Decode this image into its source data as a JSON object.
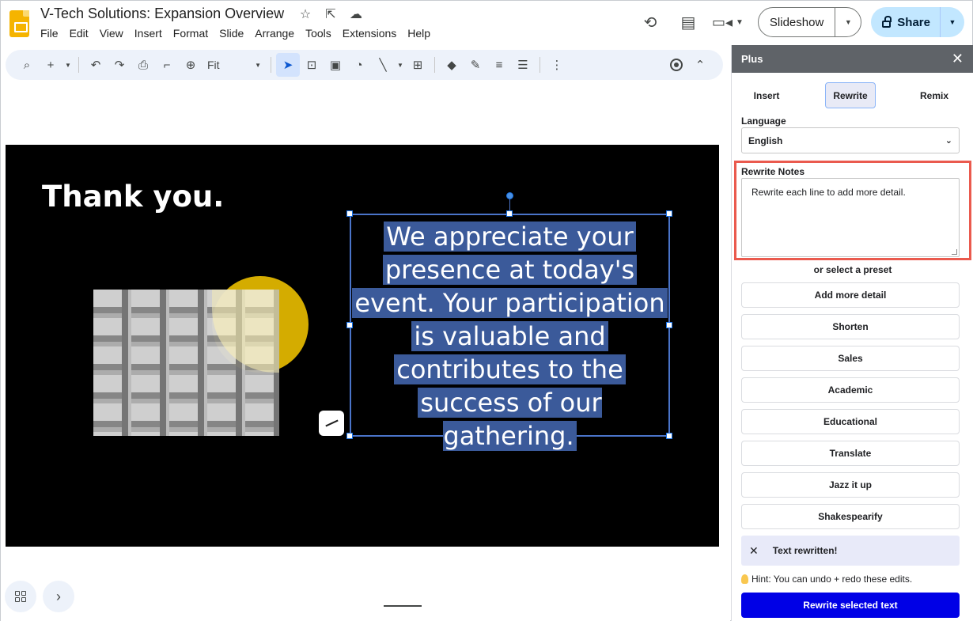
{
  "window": {
    "doc_title": "V-Tech Solutions: Expansion Overview",
    "menus": [
      "File",
      "Edit",
      "View",
      "Insert",
      "Format",
      "Slide",
      "Arrange",
      "Tools",
      "Extensions",
      "Help"
    ],
    "slideshow_label": "Slideshow",
    "share_label": "Share"
  },
  "toolbar": {
    "zoom_value": "Fit"
  },
  "slide": {
    "title": "Thank you.",
    "selected_text_lines": [
      "We appreciate your",
      "presence at today's",
      "event. Your participation",
      "is valuable and",
      "contributes to the",
      "success of our gathering."
    ]
  },
  "panel": {
    "title": "Plus",
    "tabs": [
      "Insert",
      "Rewrite",
      "Remix"
    ],
    "active_tab": "Rewrite",
    "language_label": "Language",
    "language_value": "English",
    "notes_label": "Rewrite Notes",
    "notes_value": "Rewrite each line to add more detail.",
    "preset_label": "or select a preset",
    "presets": [
      "Add more detail",
      "Shorten",
      "Sales",
      "Academic",
      "Educational",
      "Translate",
      "Jazz it up",
      "Shakespearify"
    ],
    "status_text": "Text rewritten!",
    "hint_text": "Hint: You can undo + redo these edits.",
    "primary_button": "Rewrite selected text"
  },
  "colors": {
    "accent": "#0b57d0",
    "primary_button": "#0000e6",
    "highlight_border": "#ea5a4e",
    "slide_bg": "#000000",
    "yellow_shape": "#d4ac00",
    "text_selection": "#3b5a9a"
  }
}
